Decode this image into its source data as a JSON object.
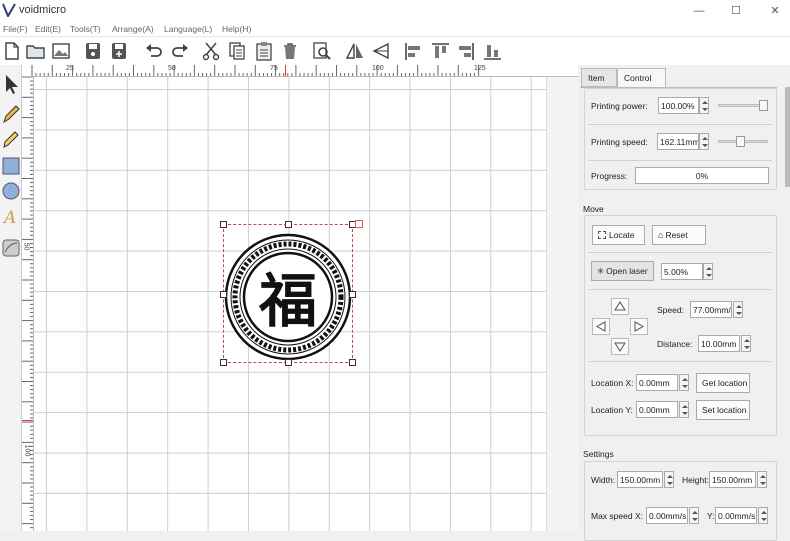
{
  "app": {
    "title": "voidmicro"
  },
  "window": {
    "minimize": "—",
    "maximize": "☐",
    "close": "✕"
  },
  "menu": [
    "File(F)",
    "Edit(E)",
    "Tools(T)",
    "Arrange(A)",
    "Language(L)",
    "Help(H)"
  ],
  "toolbar": [
    "new-file-icon",
    "open-folder-icon",
    "import-image-icon",
    "save-icon",
    "save-as-icon",
    "undo-icon",
    "redo-icon",
    "cut-icon",
    "copy-icon",
    "paste-icon",
    "delete-icon",
    "preview-icon",
    "flip-horizontal-icon",
    "flip-vertical-icon",
    "align-left-icon",
    "align-top-icon",
    "align-right-icon",
    "align-bottom-icon"
  ],
  "left_tools": [
    "select-arrow-icon",
    "pen-icon",
    "pencil-icon",
    "rectangle-icon",
    "ellipse-icon",
    "text-icon",
    "eraser-icon"
  ],
  "ruler": {
    "top_labels": [
      "25",
      "50",
      "75",
      "100",
      "125"
    ],
    "left_labels": [
      "50",
      "100"
    ]
  },
  "canvas": {
    "glyph": "福"
  },
  "tabs": {
    "item": "Item",
    "control": "Control"
  },
  "control": {
    "printing_power_label": "Printing power:",
    "printing_power_value": "100.00%",
    "printing_power_level": 1.0,
    "printing_speed_label": "Printing speed:",
    "printing_speed_value": "162.11mm",
    "printing_speed_level": 0.45,
    "progress_label": "Progress:",
    "progress_value": "0%"
  },
  "move": {
    "title": "Move",
    "locate": "Locate",
    "reset": "Reset",
    "open_laser": "Open laser",
    "laser_value": "5.00%",
    "speed_label": "Speed:",
    "speed_value": "77.00mm/",
    "distance_label": "Distance:",
    "distance_value": "10.00mm",
    "location_x_label": "Location X:",
    "location_x_value": "0.00mm",
    "get_location": "Get location",
    "location_y_label": "Location Y:",
    "location_y_value": "0.00mm",
    "set_location": "Set location"
  },
  "settings": {
    "title": "Settings",
    "width_label": "Width:",
    "width_value": "150.00mm",
    "height_label": "Height:",
    "height_value": "150.00mm",
    "max_speed_x_label": "Max speed X:",
    "max_speed_x_value": "0.00mm/s",
    "y_label": "Y:",
    "y_value": "0.00mm/s"
  },
  "colors": {
    "selection": "#cc4444",
    "grid": "#cfcfcf",
    "panel": "#f0f0f0"
  }
}
